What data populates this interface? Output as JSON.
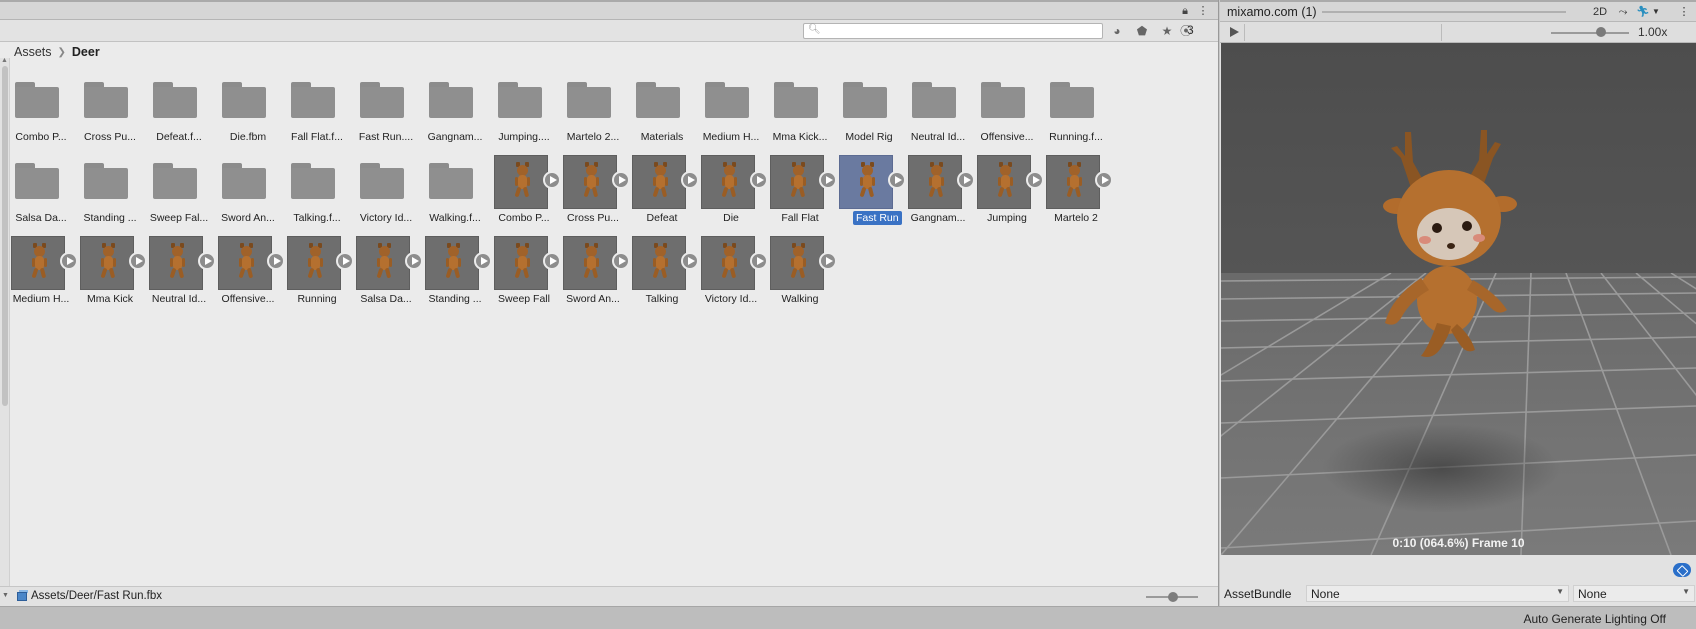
{
  "project": {
    "search": {
      "placeholder": "",
      "value": ""
    },
    "hidden_count": "3",
    "breadcrumb": {
      "root": "Assets",
      "current": "Deer"
    },
    "items": [
      {
        "label": "Combo P...",
        "kind": "folder"
      },
      {
        "label": "Cross Pu...",
        "kind": "folder"
      },
      {
        "label": "Defeat.f...",
        "kind": "folder"
      },
      {
        "label": "Die.fbm",
        "kind": "folder"
      },
      {
        "label": "Fall Flat.f...",
        "kind": "folder"
      },
      {
        "label": "Fast Run....",
        "kind": "folder"
      },
      {
        "label": "Gangnam...",
        "kind": "folder"
      },
      {
        "label": "Jumping....",
        "kind": "folder"
      },
      {
        "label": "Martelo 2...",
        "kind": "folder"
      },
      {
        "label": "Materials",
        "kind": "folder"
      },
      {
        "label": "Medium H...",
        "kind": "folder"
      },
      {
        "label": "Mma Kick...",
        "kind": "folder"
      },
      {
        "label": "Model Rig",
        "kind": "folder"
      },
      {
        "label": "Neutral Id...",
        "kind": "folder"
      },
      {
        "label": "Offensive...",
        "kind": "folder"
      },
      {
        "label": "Running.f...",
        "kind": "folder"
      },
      {
        "label": "Salsa Da...",
        "kind": "folder"
      },
      {
        "label": "Standing ...",
        "kind": "folder"
      },
      {
        "label": "Sweep Fal...",
        "kind": "folder"
      },
      {
        "label": "Sword An...",
        "kind": "folder"
      },
      {
        "label": "Talking.f...",
        "kind": "folder"
      },
      {
        "label": "Victory Id...",
        "kind": "folder"
      },
      {
        "label": "Walking.f...",
        "kind": "folder"
      },
      {
        "label": "Combo P...",
        "kind": "anim"
      },
      {
        "label": "Cross Pu...",
        "kind": "anim"
      },
      {
        "label": "Defeat",
        "kind": "anim"
      },
      {
        "label": "Die",
        "kind": "anim"
      },
      {
        "label": "Fall Flat",
        "kind": "anim"
      },
      {
        "label": "Fast Run",
        "kind": "anim",
        "selected": true
      },
      {
        "label": "Gangnam...",
        "kind": "anim"
      },
      {
        "label": "Jumping",
        "kind": "anim"
      },
      {
        "label": "Martelo 2",
        "kind": "anim"
      },
      {
        "label": "Medium H...",
        "kind": "anim"
      },
      {
        "label": "Mma Kick",
        "kind": "anim"
      },
      {
        "label": "Neutral Id...",
        "kind": "anim"
      },
      {
        "label": "Offensive...",
        "kind": "anim"
      },
      {
        "label": "Running",
        "kind": "anim"
      },
      {
        "label": "Salsa Da...",
        "kind": "anim"
      },
      {
        "label": "Standing ...",
        "kind": "anim"
      },
      {
        "label": "Sweep Fall",
        "kind": "anim"
      },
      {
        "label": "Sword An...",
        "kind": "anim"
      },
      {
        "label": "Talking",
        "kind": "anim"
      },
      {
        "label": "Victory Id...",
        "kind": "anim"
      },
      {
        "label": "Walking",
        "kind": "anim"
      }
    ],
    "footer_path": "Assets/Deer/Fast Run.fbx"
  },
  "preview": {
    "title": "mixamo.com (1)",
    "btn_2d": "2D",
    "speed": "1.00x",
    "status": "0:10 (064.6%) Frame 10",
    "assetbundle_label": "AssetBundle",
    "assetbundle_value": "None",
    "variant_value": "None"
  },
  "statusbar": {
    "text": "Auto Generate Lighting Off"
  },
  "colors": {
    "selection": "#3a72c4",
    "accent": "#2a6fc9",
    "character": "#b5702f"
  }
}
